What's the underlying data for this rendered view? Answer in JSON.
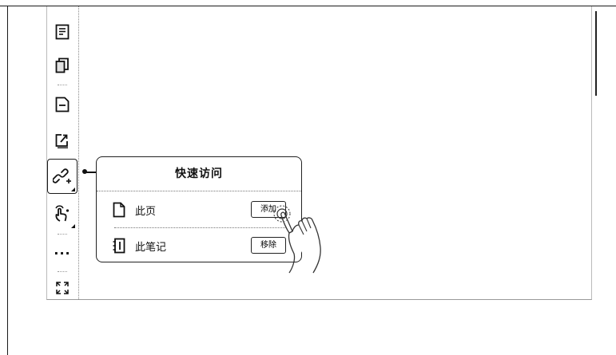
{
  "toolbar": {
    "items": [
      {
        "name": "toc",
        "icon": "document-lines-icon"
      },
      {
        "name": "pages",
        "icon": "copy-pages-icon"
      },
      {
        "name": "page-remove",
        "icon": "page-minus-icon"
      },
      {
        "name": "export",
        "icon": "export-share-icon"
      },
      {
        "name": "quick-access",
        "icon": "link-add-icon",
        "active": true
      },
      {
        "name": "gesture",
        "icon": "hand-gesture-icon"
      },
      {
        "name": "more",
        "icon": "more-dots-icon",
        "label": "···"
      },
      {
        "name": "fullscreen",
        "icon": "expand-arrows-icon"
      }
    ]
  },
  "popup": {
    "title": "快速访问",
    "rows": [
      {
        "icon": "page-icon",
        "label": "此页",
        "button": "添加"
      },
      {
        "icon": "notebook-icon",
        "label": "此笔记",
        "button": "移除"
      }
    ]
  },
  "colors": {
    "line": "#1a1a1a",
    "background": "#ffffff",
    "divider": "#777777"
  }
}
